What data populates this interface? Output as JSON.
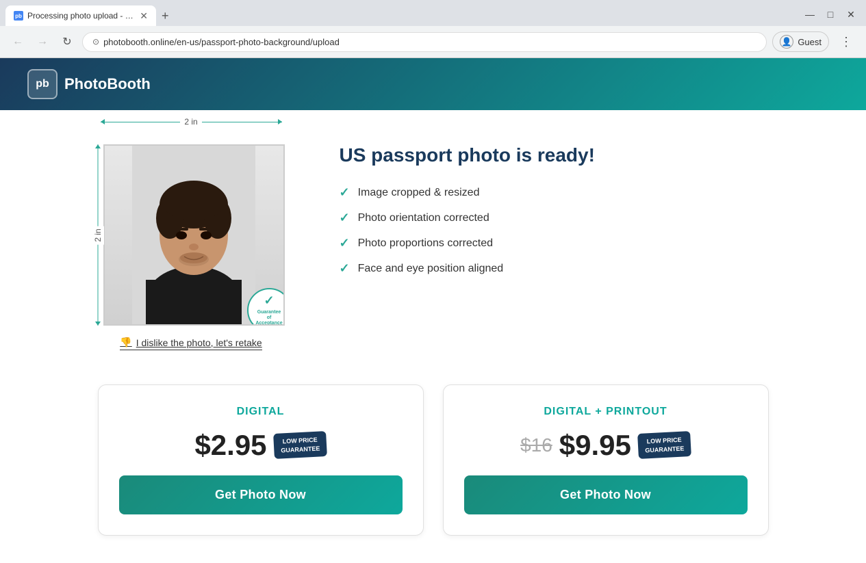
{
  "browser": {
    "tab_title": "Processing photo upload - P...",
    "tab_favicon_text": "pb",
    "url": "photobooth.online/en-us/passport-photo-background/upload",
    "new_tab_label": "+",
    "back_btn": "←",
    "forward_btn": "→",
    "refresh_btn": "↻",
    "security_icon": "⊙",
    "menu_btn": "⋮",
    "profile_label": "Guest",
    "profile_icon": "👤",
    "win_minimize": "—",
    "win_maximize": "□",
    "win_close": "✕"
  },
  "header": {
    "logo_text": "pb",
    "brand_name": "PhotoBooth"
  },
  "photo_section": {
    "dimension_top": "2 in",
    "dimension_left": "2 in",
    "guarantee_text_line1": "Guarantee",
    "guarantee_text_line2": "of",
    "guarantee_text_line3": "Acceptance",
    "retake_label": "I dislike the photo, let's retake"
  },
  "info_section": {
    "title": "US passport photo is ready!",
    "checklist": [
      "Image cropped & resized",
      "Photo orientation corrected",
      "Photo proportions corrected",
      "Face and eye position aligned"
    ]
  },
  "pricing": {
    "digital": {
      "type_label": "DIGITAL",
      "price": "$2.95",
      "badge_line1": "LOW PRICE",
      "badge_line2": "GUARANTEE",
      "btn_label": "Get Photo Now"
    },
    "digital_printout": {
      "type_label": "DIGITAL + PRINTOUT",
      "price_old": "$16",
      "price_new": "$9.95",
      "badge_line1": "LOW PRICE",
      "badge_line2": "GUARANTEE",
      "btn_label": "Get Photo Now"
    }
  }
}
